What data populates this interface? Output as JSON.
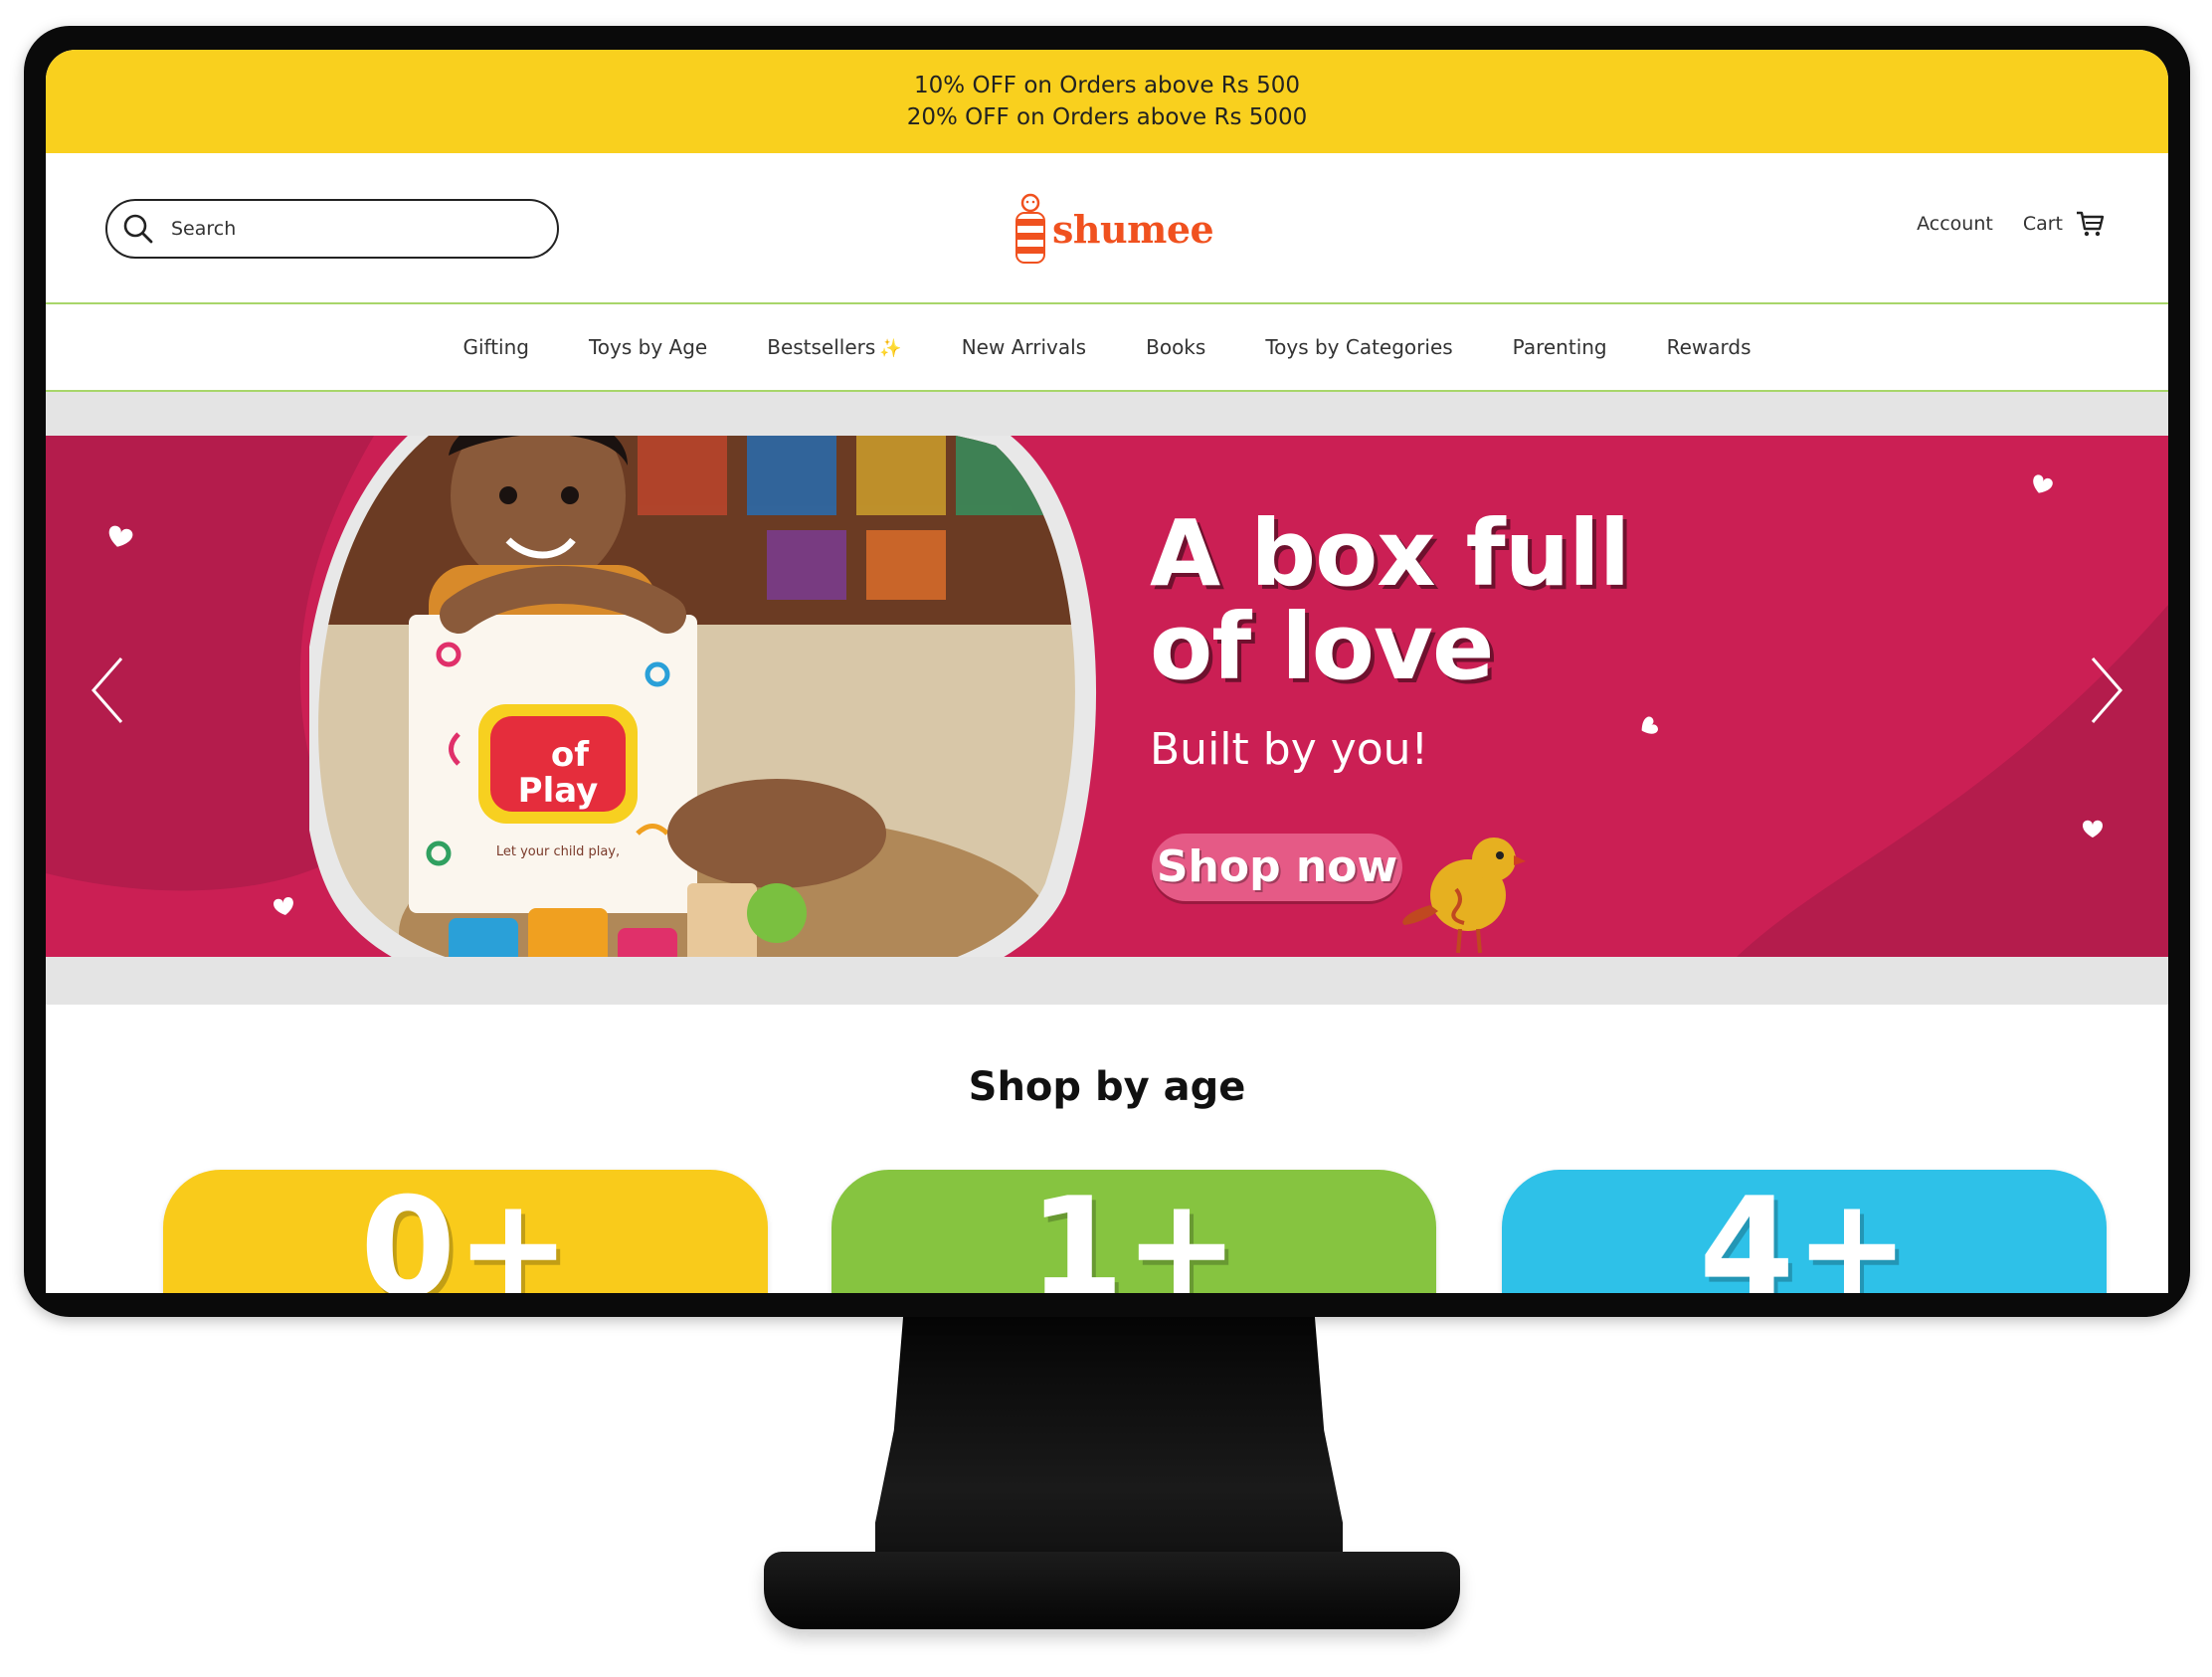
{
  "announcement": {
    "line1": "10% OFF on Orders above Rs 500",
    "line2": "20% OFF on Orders above Rs 5000"
  },
  "header": {
    "search_placeholder": "Search",
    "logo_text": "shumee",
    "account_label": "Account",
    "cart_label": "Cart"
  },
  "nav": {
    "items": [
      {
        "label": "Gifting"
      },
      {
        "label": "Toys by Age"
      },
      {
        "label": "Bestsellers"
      },
      {
        "label": "New Arrivals"
      },
      {
        "label": "Books"
      },
      {
        "label": "Toys by Categories"
      },
      {
        "label": "Parenting"
      },
      {
        "label": "Rewards"
      }
    ],
    "sparkle": "✨"
  },
  "hero": {
    "title_line1": "A box full",
    "title_line2": "of love",
    "subtitle": "Built by you!",
    "cta_label": "Shop now",
    "box_text_line1": "of",
    "box_text_line2": "Play",
    "box_caption": "Let your child play,",
    "colors": {
      "background": "#cb1f54",
      "button": "#e55a86",
      "photo_frame": "#e8e8e8"
    }
  },
  "shop_by_age": {
    "title": "Shop by age",
    "cards": [
      {
        "label": "0+",
        "color": "#f9cb1b"
      },
      {
        "label": "1+",
        "color": "#86c440"
      },
      {
        "label": "4+",
        "color": "#2ec1e8"
      }
    ]
  },
  "colors": {
    "announcement_bg": "#f9d01e",
    "nav_border": "#a8d66a",
    "logo": "#f0511f"
  }
}
